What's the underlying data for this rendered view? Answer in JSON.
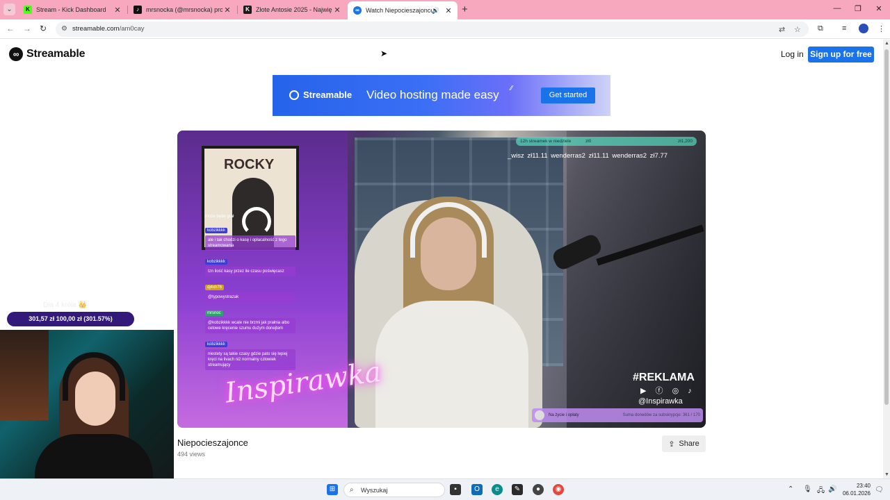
{
  "browser": {
    "tabs": [
      {
        "title": "Stream - Kick Dashboard",
        "favicon": "kick-icon",
        "color": "#53fc18"
      },
      {
        "title": "mrsnocka (@mrsnocka) prowadz",
        "favicon": "tiktok-icon",
        "color": "#111111"
      },
      {
        "title": "Złote Antosie 2025 - Największa",
        "favicon": "kick-icon",
        "color": "#1b1b1b"
      },
      {
        "title": "Watch Niepocieszajonce | Str",
        "favicon": "streamable-icon",
        "color": "#1a73e8",
        "active": true
      }
    ],
    "url_host": "streamable.com",
    "url_path": "/am0cay"
  },
  "site": {
    "logo_text": "Streamable",
    "login_label": "Log in",
    "signup_label": "Sign up for free",
    "banner": {
      "brand": "Streamable",
      "tagline": "Video hosting made easy",
      "cta": "Get started"
    },
    "video": {
      "title": "Niepocieszajonce",
      "views": "494 views",
      "share_label": "Share",
      "overlay": {
        "poster_title": "ROCKY",
        "ticker_left": "12h streamek w niedziele",
        "ticker_mid": "zł0",
        "ticker_right": "zł1,200",
        "donors": "_wisz zł11.11   wenderras2 zł11.11   wenderras2 zł7.77",
        "reklama": "#REKLAMA",
        "social_handle": "@Inspirawka",
        "neon_sign": "Inspirawka",
        "sub_bar_left": "Na życie i opłaty",
        "sub_bar_right": "Suma donedów za subskrypcje: 361 / 170",
        "chat": [
          {
            "type": "text",
            "text": "może będę grał"
          },
          {
            "type": "user",
            "text": "kobzikkkk",
            "style": "blue"
          },
          {
            "type": "text",
            "text": "ale i tak chodzi o kasę i opłacalność z tego streamowania"
          },
          {
            "type": "user",
            "text": "kobzikkkk",
            "style": "blue"
          },
          {
            "type": "text",
            "text": "tzn ilość kasy przez ile czasu poświęcasz"
          },
          {
            "type": "user",
            "text": "dj4xh76",
            "style": "yellow"
          },
          {
            "type": "text",
            "text": "@typowystrazak"
          },
          {
            "type": "user",
            "text": "mrsnoc",
            "style": "green"
          },
          {
            "type": "text",
            "text": "@kobzikkkk wcale nie brzmi jak prałnia albo celowe kręcenie szumu dużym donejtem"
          },
          {
            "type": "user",
            "text": "kobzikkkk",
            "style": "blue"
          },
          {
            "type": "text",
            "text": "niestety są takie czasy gdzie pato się lepiej kręci na livach niż normalny człowiek streamujący"
          }
        ]
      }
    }
  },
  "stream_overlay": {
    "goal_label": "Dla 4 króla 👑",
    "goal_value": "301,57 zł    100,00 zł (301.57%)"
  },
  "taskbar": {
    "search_placeholder": "Wyszukaj",
    "time": "23:40",
    "date": "06.01.2026"
  }
}
